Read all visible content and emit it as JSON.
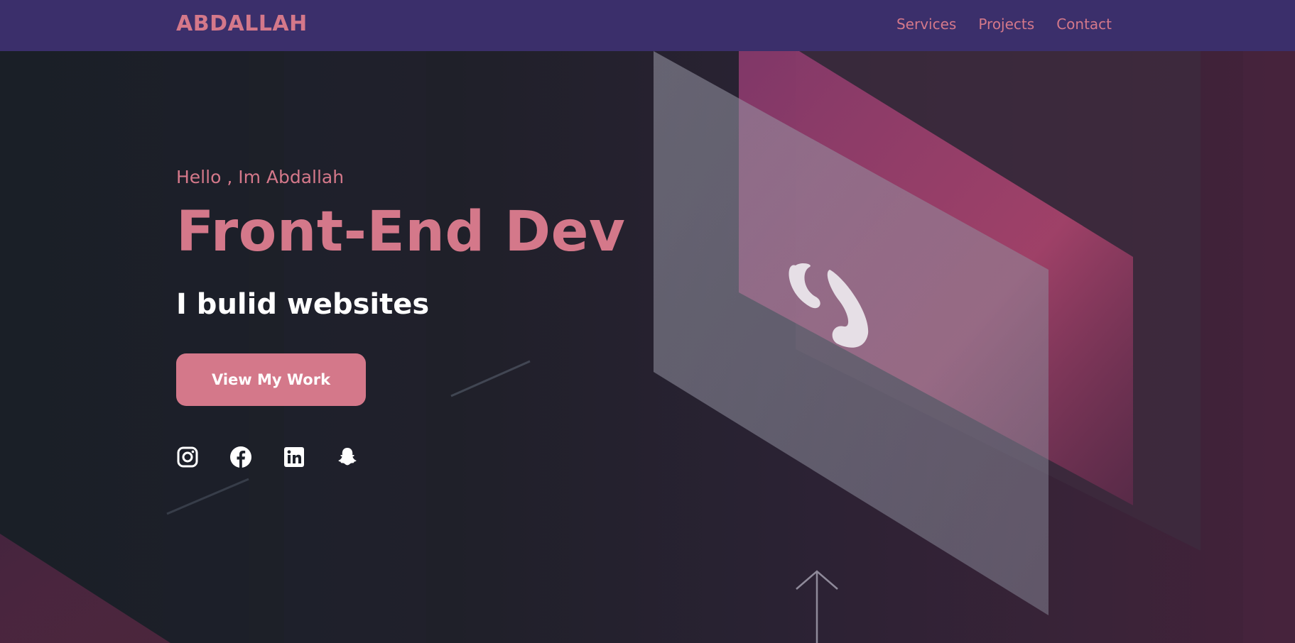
{
  "brand": {
    "name": "ABDALLAH"
  },
  "nav": {
    "links": [
      {
        "label": "Services"
      },
      {
        "label": "Projects"
      },
      {
        "label": "Contact"
      }
    ]
  },
  "hero": {
    "greeting": "Hello , Im Abdallah",
    "title": "Front-End Dev",
    "subtitle": "I bulid websites",
    "cta_label": "View My Work",
    "socials": [
      "instagram-icon",
      "facebook-icon",
      "linkedin-icon",
      "snapchat-icon"
    ]
  },
  "colors": {
    "navbar": "#3b2f6b",
    "accent": "#d4788a",
    "text_light": "#ffffff",
    "background": "#1a1f28"
  }
}
